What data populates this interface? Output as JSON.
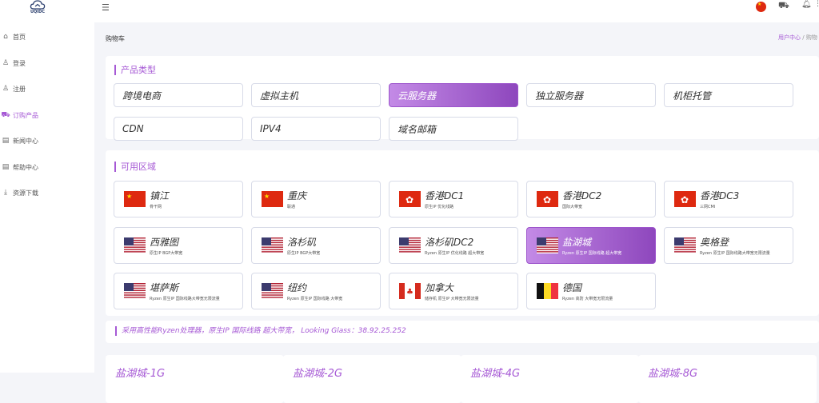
{
  "brand": {
    "logo_text": "UQIDC"
  },
  "sidebar": {
    "items": [
      {
        "icon": "home-icon",
        "glyph": "⌂",
        "label": "首页"
      },
      {
        "icon": "user-icon",
        "glyph": "♙",
        "label": "登录"
      },
      {
        "icon": "user-plus-icon",
        "glyph": "♙",
        "label": "注册"
      },
      {
        "icon": "cart-icon",
        "glyph": "⛟",
        "label": "订购产品"
      },
      {
        "icon": "news-icon",
        "glyph": "▤",
        "label": "新闻中心"
      },
      {
        "icon": "help-icon",
        "glyph": "▤",
        "label": "帮助中心"
      },
      {
        "icon": "download-icon",
        "glyph": "⤓",
        "label": "资源下载"
      }
    ]
  },
  "header": {
    "title": "购物车",
    "breadcrumb_home": "用户中心",
    "breadcrumb_sep": "/",
    "breadcrumb_current": "购物"
  },
  "product_types": {
    "title": "产品类型",
    "selected": "云服务器",
    "items": [
      "跨境电商",
      "虚拟主机",
      "云服务器",
      "独立服务器",
      "机柜托管",
      "CDN",
      "IPV4",
      "域名邮箱"
    ]
  },
  "regions": {
    "title": "可用区域",
    "selected": "盐湖城",
    "items": [
      {
        "name": "镇江",
        "sub": "骨干网",
        "flag": "cn"
      },
      {
        "name": "重庆",
        "sub": "联通",
        "flag": "cn"
      },
      {
        "name": "香港DC1",
        "sub": "原生IP 优化线路",
        "flag": "hk"
      },
      {
        "name": "香港DC2",
        "sub": "国际大带宽",
        "flag": "hk"
      },
      {
        "name": "香港DC3",
        "sub": "三网CMI",
        "flag": "hk"
      },
      {
        "name": "西雅图",
        "sub": "原生IP BGP大带宽",
        "flag": "us"
      },
      {
        "name": "洛杉矶",
        "sub": "原生IP BGP大带宽",
        "flag": "us"
      },
      {
        "name": "洛杉矶DC2",
        "sub": "Ryzen 原生IP 优化线路 超大带宽",
        "flag": "us"
      },
      {
        "name": "盐湖城",
        "sub": "Ryzen 原生IP 国际线路 超大带宽",
        "flag": "us"
      },
      {
        "name": "奥格登",
        "sub": "Ryzen 原生IP 国际线路大带宽无限流量",
        "flag": "us"
      },
      {
        "name": "堪萨斯",
        "sub": "Ryzen 原生IP 国际线路大带宽无限流量",
        "flag": "us"
      },
      {
        "name": "纽约",
        "sub": "Ryzen 原生IP 国际线路 大带宽",
        "flag": "us"
      },
      {
        "name": "加拿大",
        "sub": "储存机 原生IP 大带宽无限流量",
        "flag": "ca"
      },
      {
        "name": "德国",
        "sub": "Ryzen 高防 大带宽无限流量",
        "flag": "be"
      }
    ]
  },
  "info": {
    "text": "采用高性能Ryzen处理器，原生IP 国际线路 超大带宽，  Looking Glass：38.92.25.252"
  },
  "plans": [
    "盐湖城-1G",
    "盐湖城-2G",
    "盐湖城-4G",
    "盐湖城-8G"
  ],
  "colors": {
    "accent": "#a659d5",
    "accent_dark": "#8e47bd"
  }
}
